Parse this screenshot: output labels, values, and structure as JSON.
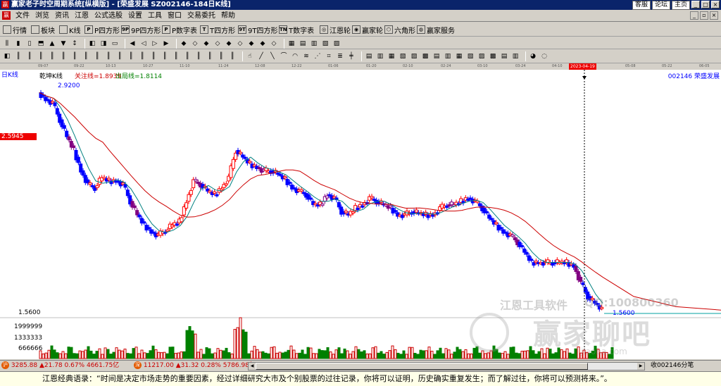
{
  "window": {
    "title": "赢家老子时空周期系统[纵横版] - [荣盛发展  SZ002146-184日K线]",
    "top_links": [
      "客服",
      "论坛",
      "主页"
    ],
    "controls": [
      "_",
      "□",
      "×"
    ]
  },
  "menu": {
    "items": [
      "文件",
      "浏览",
      "资讯",
      "江恩",
      "公式选股",
      "设置",
      "工具",
      "窗口",
      "交易委托",
      "帮助"
    ],
    "right_controls": [
      "_",
      "▫",
      "×"
    ]
  },
  "toolbar1": {
    "items": [
      {
        "label": "行情",
        "icon": "grid-icon"
      },
      {
        "label": "板块",
        "icon": "blocks-icon"
      },
      {
        "label": "K线",
        "icon": "candlestick-icon"
      },
      {
        "label": "P四方形",
        "icon": "p-square-icon",
        "badge": "P"
      },
      {
        "label": "9P四方形",
        "icon": "9p-square-icon",
        "badge": "9P"
      },
      {
        "label": "P数字表",
        "icon": "p-number-icon",
        "badge": "P"
      },
      {
        "label": "T四方形",
        "icon": "t-square-icon",
        "badge": "T"
      },
      {
        "label": "9T四方形",
        "icon": "9t-square-icon",
        "badge": "9T"
      },
      {
        "label": "T数字表",
        "icon": "t-number-icon",
        "badge": "TN"
      },
      {
        "label": "江恩轮",
        "icon": "gann-wheel-icon",
        "badge": "◎"
      },
      {
        "label": "赢家轮",
        "icon": "winner-wheel-icon",
        "badge": "◉"
      },
      {
        "label": "六角形",
        "icon": "hexagon-icon",
        "badge": "⬡"
      },
      {
        "label": "赢家服务",
        "icon": "service-icon",
        "badge": "◍"
      }
    ]
  },
  "timeaxis": {
    "ticks": [
      "09-07",
      "09-22",
      "10-13",
      "10-27",
      "11-10",
      "11-24",
      "12-08",
      "12-22",
      "01-06",
      "01-20",
      "02-10",
      "02-24",
      "03-10",
      "03-24",
      "04-10",
      "05-08",
      "05-22",
      "06-05"
    ],
    "highlight": "2023-04-19"
  },
  "chart": {
    "period_label": "日K线",
    "indicator_name": "乾坤K线",
    "focus_line": "关注线=1.8939",
    "exit_line": "出局线=1.8114",
    "stock_label": "002146  荣盛发展",
    "high_label": "2.9200",
    "low_label": "1.5600",
    "price_marker": "2.5945",
    "price_axis_low": "1.5600",
    "volume_axis": [
      "1999999",
      "1333333",
      "666666"
    ],
    "watermark_tool": "江恩工具软件",
    "watermark_qq": "QQ:100800360",
    "watermark_brand": "赢家聊吧",
    "watermark_site": "jiaoba.com"
  },
  "chart_data": {
    "type": "candlestick",
    "price_ylim": [
      1.56,
      2.92
    ],
    "high": 2.92,
    "low": 1.56,
    "focus_line": 1.8939,
    "exit_line": 1.8114,
    "volume_ticks": [
      666666,
      1333333,
      1999999
    ]
  },
  "statusbar": {
    "index1": "3285.88",
    "index1_change": "▲21.78 0.67% 4661.75亿",
    "index2": "11217.00",
    "index2_change": "▲31.32 0.28% 5786.98亿",
    "stock_info": "收002146分笔"
  },
  "quote": "江恩经典语录：“时间是决定市场走势的重要因素，经过详细研究大市及个别股票的过往记录，你将可以证明，历史确实重复发生；而了解过往，你将可以预测将来。”。",
  "colors": {
    "up": "#ff0000",
    "down": "#0000ff",
    "neutral": "#800080",
    "volume_up": "#cc0000",
    "volume_down": "#008000",
    "ma_short": "#008080",
    "ma_long": "#cc0000"
  }
}
